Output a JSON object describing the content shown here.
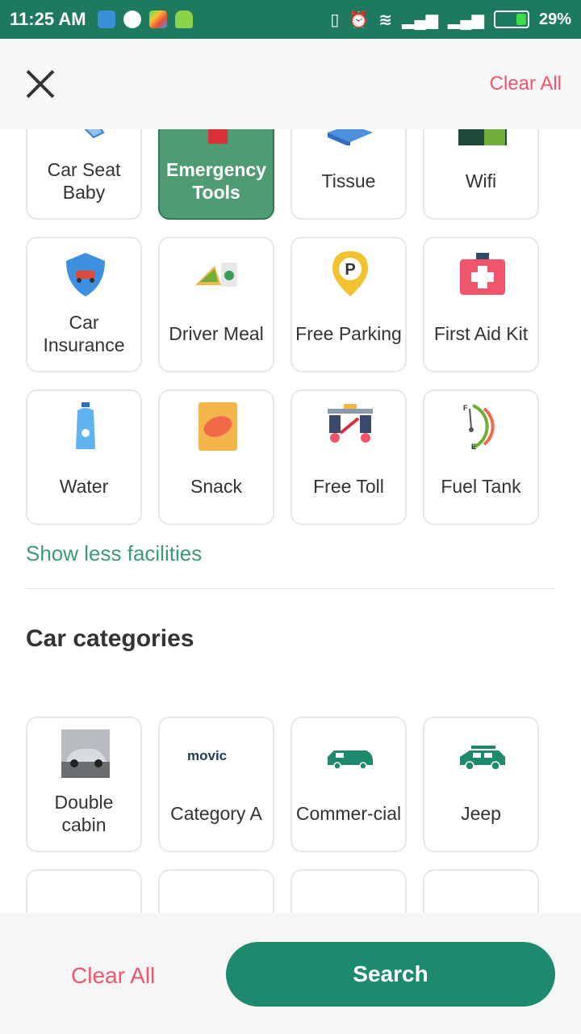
{
  "status": {
    "time": "11:25 AM",
    "battery": "29%"
  },
  "header": {
    "clear_all": "Clear All"
  },
  "facilities": {
    "row1": [
      "Car Seat Baby",
      "Emergency Tools",
      "Tissue",
      "Wifi"
    ],
    "row2": [
      "Car Insurance",
      "Driver Meal",
      "Free Parking",
      "First Aid Kit"
    ],
    "row3": [
      "Water",
      "Snack",
      "Free Toll",
      "Fuel Tank"
    ],
    "show_less": "Show less facilities"
  },
  "car_categories": {
    "title": "Car categories",
    "items": [
      "Double cabin",
      "Category A",
      "Commer-cial",
      "Jeep"
    ],
    "movic_logo": "movic"
  },
  "footer": {
    "clear_all": "Clear All",
    "search": "Search"
  },
  "colors": {
    "primary": "#1e8a6d",
    "accent_red": "#f0556d",
    "selected": "#4f9b72"
  }
}
